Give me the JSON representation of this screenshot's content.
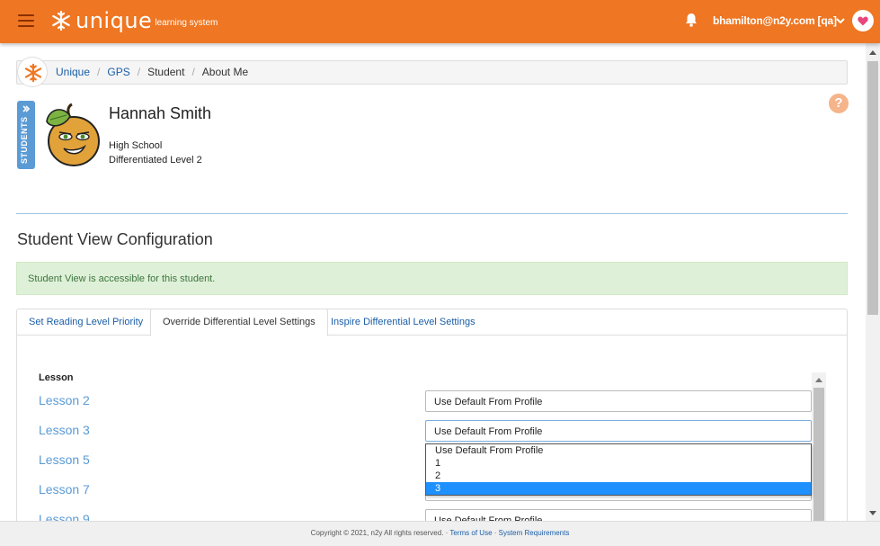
{
  "header": {
    "logo_word": "unique",
    "logo_sub": "learning system",
    "user": "bhamilton@n2y.com [qa]",
    "accent_color": "#ef7622"
  },
  "breadcrumb": {
    "items": [
      "Unique",
      "GPS",
      "Student",
      "About Me"
    ],
    "separator": "/"
  },
  "student": {
    "tab_label": "STUDENTS",
    "name": "Hannah Smith",
    "school": "High School",
    "level": "Differentiated Level 2",
    "help_symbol": "?"
  },
  "section": {
    "title": "Student View Configuration",
    "alert": "Student View is accessible for this student."
  },
  "tabs": [
    {
      "label": "Set Reading Level Priority",
      "active": false
    },
    {
      "label": "Override Differential Level Settings",
      "active": true
    },
    {
      "label": "Inspire Differential Level Settings",
      "active": false
    }
  ],
  "lessons": {
    "header": "Lesson",
    "rows": [
      {
        "label": "Lesson 2",
        "value": "Use Default From Profile"
      },
      {
        "label": "Lesson 3",
        "value": "Use Default From Profile"
      },
      {
        "label": "Lesson 5",
        "value": ""
      },
      {
        "label": "Lesson 7",
        "value": ""
      },
      {
        "label": "Lesson 9",
        "value": "Use Default From Profile"
      }
    ],
    "dropdown_options": [
      "Use Default From Profile",
      "1",
      "2",
      "3"
    ],
    "dropdown_selected": "3"
  },
  "footer": {
    "copyright": "Copyright © 2021, n2y All rights reserved. · ",
    "terms": "Terms of Use",
    "mid": " · ",
    "requirements": "System Requirements"
  }
}
